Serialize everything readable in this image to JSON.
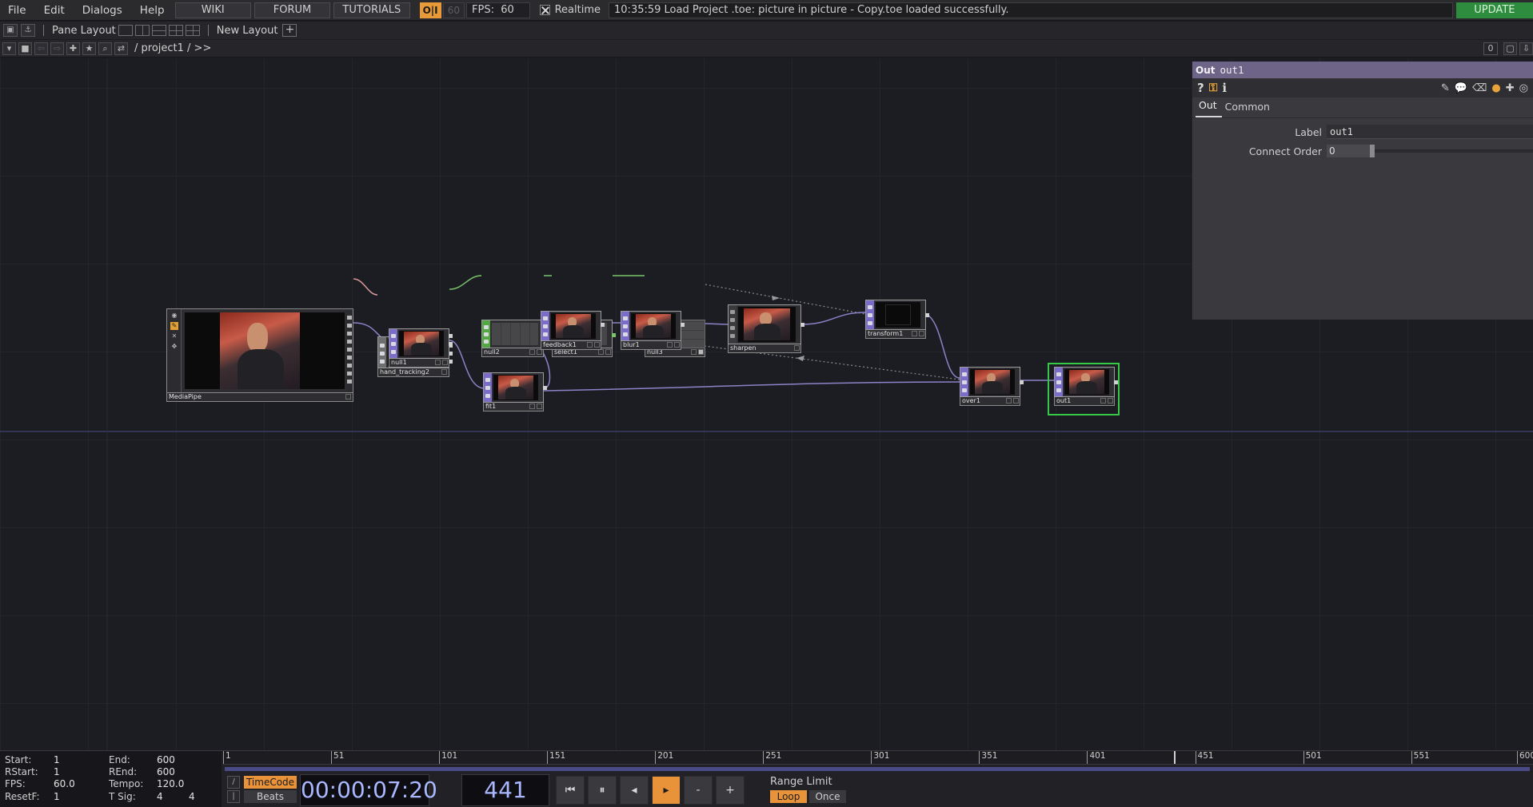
{
  "menu": {
    "items": [
      "File",
      "Edit",
      "Dialogs",
      "Help"
    ],
    "wiki": "WIKI",
    "forum": "FORUM",
    "tutorials": "TUTORIALS",
    "perf_label": "O|I",
    "fps_dim": "60",
    "fps_label": "FPS:",
    "fps_value": "60",
    "realtime_label": "Realtime",
    "status": "10:35:59 Load Project .toe: picture in picture - Copy.toe loaded successfully.",
    "update": "UPDATE"
  },
  "layoutbar": {
    "pane_layout": "Pane Layout",
    "new_layout": "New Layout"
  },
  "pathbar": {
    "path": "/ project1 / >>",
    "right_counter": "0"
  },
  "network": {
    "nodes": [
      {
        "id": "mediapipe",
        "label": "MediaPipe",
        "family": "comp"
      },
      {
        "id": "hand_tracking2",
        "label": "hand_tracking2",
        "family": "top"
      },
      {
        "id": "null2",
        "label": "null2",
        "family": "chop"
      },
      {
        "id": "select1",
        "label": "select1",
        "family": "chop"
      },
      {
        "id": "null3",
        "label": "null3",
        "family": "dat"
      },
      {
        "id": "null1",
        "label": "null1",
        "family": "top"
      },
      {
        "id": "feedback1",
        "label": "feedback1",
        "family": "top"
      },
      {
        "id": "blur1",
        "label": "blur1",
        "family": "top"
      },
      {
        "id": "sharpen",
        "label": "sharpen",
        "family": "comp"
      },
      {
        "id": "transform1",
        "label": "transform1",
        "family": "top"
      },
      {
        "id": "fit1",
        "label": "fit1",
        "family": "top"
      },
      {
        "id": "over1",
        "label": "over1",
        "family": "top"
      },
      {
        "id": "out1",
        "label": "out1",
        "family": "top",
        "selected": true
      }
    ]
  },
  "params": {
    "op_type": "Out",
    "op_name": "out1",
    "tabs": [
      "Out",
      "Common"
    ],
    "active_tab": "Out",
    "label_param": {
      "label": "Label",
      "value": "out1"
    },
    "connect_order": {
      "label": "Connect Order",
      "value": "0"
    },
    "colors": {
      "header": "#6e6488",
      "python_icon": "#e8a43a"
    }
  },
  "timeline": {
    "info": {
      "start_k": "Start:",
      "start_v": "1",
      "end_k": "End:",
      "end_v": "600",
      "rstart_k": "RStart:",
      "rstart_v": "1",
      "rend_k": "REnd:",
      "rend_v": "600",
      "fps_k": "FPS:",
      "fps_v": "60.0",
      "tempo_k": "Tempo:",
      "tempo_v": "120.0",
      "resetf_k": "ResetF:",
      "resetf_v": "1",
      "tsig_k": "T Sig:",
      "tsig_v1": "4",
      "tsig_v2": "4"
    },
    "ticks": [
      "1",
      "51",
      "101",
      "151",
      "201",
      "251",
      "301",
      "351",
      "401",
      "451",
      "501",
      "551",
      "600"
    ],
    "range": {
      "start": 1,
      "end": 600
    },
    "current_frame": 441,
    "timecode_button": "TimeCode",
    "beats_button": "Beats",
    "timecode": "00:00:07:20",
    "frame": "441",
    "minus": "-",
    "plus": "+",
    "range_limit": "Range Limit",
    "loop": "Loop",
    "once": "Once"
  }
}
